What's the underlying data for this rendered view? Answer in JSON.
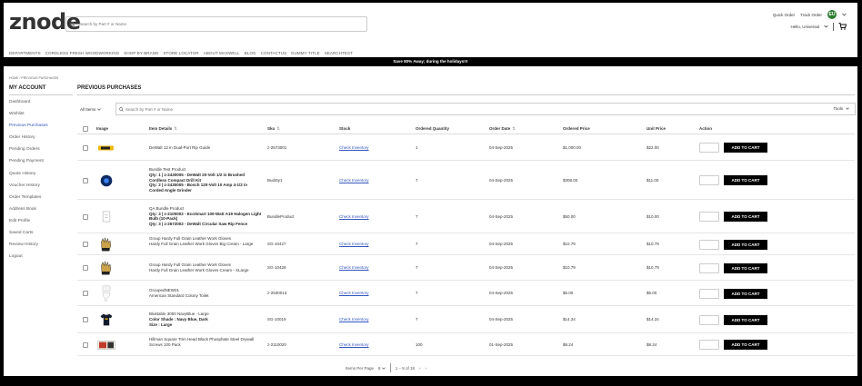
{
  "header": {
    "logo": "znode",
    "search_placeholder": "Search by Part # or Name",
    "quick_order": "Quick Order",
    "track_order": "Track Order",
    "badge": "EU",
    "greeting": "Hello, Universal",
    "icons": {
      "search": "search-icon",
      "cart": "cart-icon",
      "chevron": "chevron-down-icon"
    }
  },
  "nav": [
    "DEPARTMENTS",
    "CORDLESS FRESH WOODWORKING",
    "SHOP BY BRAND",
    "STORE LOCATOR",
    "ABOUT MAXWELL",
    "BLOG",
    "CONTACTUS",
    "DUMMY TITLE",
    "SEARCHTEST"
  ],
  "promo": "Save 80% Away; during the holidays!!!",
  "breadcrumb": "HOME / PREVIOUS PURCHASES",
  "sidebar": {
    "title": "MY ACCOUNT",
    "items": [
      {
        "label": "Dashboard",
        "active": false
      },
      {
        "label": "Wishlist",
        "active": false
      },
      {
        "label": "Previous Purchases",
        "active": true
      },
      {
        "label": "Order History",
        "active": false
      },
      {
        "label": "Pending Orders",
        "active": false
      },
      {
        "label": "Pending Payment",
        "active": false
      },
      {
        "label": "Quote History",
        "active": false
      },
      {
        "label": "Voucher History",
        "active": false
      },
      {
        "label": "Order Templates",
        "active": false
      },
      {
        "label": "Address Book",
        "active": false
      },
      {
        "label": "Edit Profile",
        "active": false
      },
      {
        "label": "Saved Carts",
        "active": false
      },
      {
        "label": "Review History",
        "active": false
      },
      {
        "label": "Logout",
        "active": false
      }
    ]
  },
  "main": {
    "title": "PREVIOUS PURCHASES",
    "filter_label": "All Items",
    "search_placeholder": "Search by Part # or Name",
    "tools_label": "Tools"
  },
  "table": {
    "headers": {
      "image": "Image",
      "details": "Item Details",
      "sku": "Sku",
      "stock": "Stock",
      "ordered_qty": "Ordered Quantity",
      "order_date": "Order Date",
      "ordered_price": "Ordered Price",
      "unit_price": "Unit Price",
      "action": "Action"
    },
    "add_label": "ADD TO CART",
    "rows": [
      {
        "lines": [
          {
            "t": "DeWalt 12 in Dual-Port Rip Guide",
            "b": false
          }
        ],
        "sku": "z-2673001",
        "stock": "Check Inventory",
        "qty": "1",
        "date": "04-Sep-2025",
        "ordered_price": "$1,000.00",
        "unit_price": "$22.00",
        "image": "rip-guide"
      },
      {
        "lines": [
          {
            "t": "Bundle Test Product",
            "b": false
          },
          {
            "t": "Qty: 1 | z-2430005 - DeWalt 20-Volt 1/2 in Brushed Cordless Compact Drill Kit",
            "b": true
          },
          {
            "t": "Qty: 2 | z-2430005 - Bosch 120-Volt 10 Amp 4-1/2 in Corded Angle Grinder",
            "b": true
          }
        ],
        "sku": "Bud4ty1",
        "stock": "Check Inventory",
        "qty": "7",
        "date": "04-Sep-2025",
        "ordered_price": "$308.00",
        "unit_price": "$11.00",
        "image": "blue-disc"
      },
      {
        "lines": [
          {
            "t": "QA Bundle Product",
            "b": false
          },
          {
            "t": "Qty: 3 | z-2100002 - EcoSmart 100-Watt A19 Halogen Light Bulb (10-Pack)",
            "b": true
          },
          {
            "t": "Qty: 3 | z-2672002 - DeWalt Circular Saw Rip Fence",
            "b": true
          }
        ],
        "sku": "BundleProduct",
        "stock": "Check Inventory",
        "qty": "7",
        "date": "04-Sep-2025",
        "ordered_price": "$50.00",
        "unit_price": "$10.00",
        "image": "placeholder"
      },
      {
        "lines": [
          {
            "t": "Group Hardy Full Grain Leather Work Gloves",
            "b": false
          },
          {
            "t": "Hardy Full Grain Leather Work Gloves Big Cream - Large",
            "b": false
          }
        ],
        "sku": "SG-10427",
        "stock": "Check Inventory",
        "qty": "7",
        "date": "04-Sep-2025",
        "ordered_price": "$10.79",
        "unit_price": "$10.79",
        "image": "gloves"
      },
      {
        "lines": [
          {
            "t": "Group Hardy Full Grain Leather Work Gloves",
            "b": false
          },
          {
            "t": "Hardy Full Grain Leather Work Gloves Cream - XLarge",
            "b": false
          }
        ],
        "sku": "SG-10428",
        "stock": "Check Inventory",
        "qty": "7",
        "date": "04-Sep-2025",
        "ordered_price": "$10.79",
        "unit_price": "$10.79",
        "image": "gloves"
      },
      {
        "lines": [
          {
            "t": "GroupedNEW01",
            "b": false
          },
          {
            "t": "American Standard Colony Toilet",
            "b": false
          }
        ],
        "sku": "z-2530013",
        "stock": "Check Inventory",
        "qty": "7",
        "date": "04-Sep-2025",
        "ordered_price": "$5.00",
        "unit_price": "$5.00",
        "image": "toilet"
      },
      {
        "lines": [
          {
            "t": "Bluktable 3000 NavyBlue - Large",
            "b": false
          },
          {
            "t": "Color Shade : Navy Blue, Dark",
            "b": true
          },
          {
            "t": "Size : Large",
            "b": true
          }
        ],
        "sku": "SG-10019",
        "stock": "Check Inventory",
        "qty": "7",
        "date": "04-Sep-2025",
        "ordered_price": "$14.34",
        "unit_price": "$14.34",
        "image": "tshirt"
      },
      {
        "lines": [
          {
            "t": "Hillman Square Trim Head Black Phosphate Steel Drywall",
            "b": false
          },
          {
            "t": "Screws 100 Pack",
            "b": false
          }
        ],
        "sku": "z-2110020",
        "stock": "Check Inventory",
        "qty": "100",
        "date": "01-Sep-2025",
        "ordered_price": "$8.24",
        "unit_price": "$8.24",
        "image": "screws-box"
      }
    ]
  },
  "pager": {
    "items_per_page_label": "Items Per Page",
    "per_page": "8",
    "range": "1 – 8 of 18"
  }
}
